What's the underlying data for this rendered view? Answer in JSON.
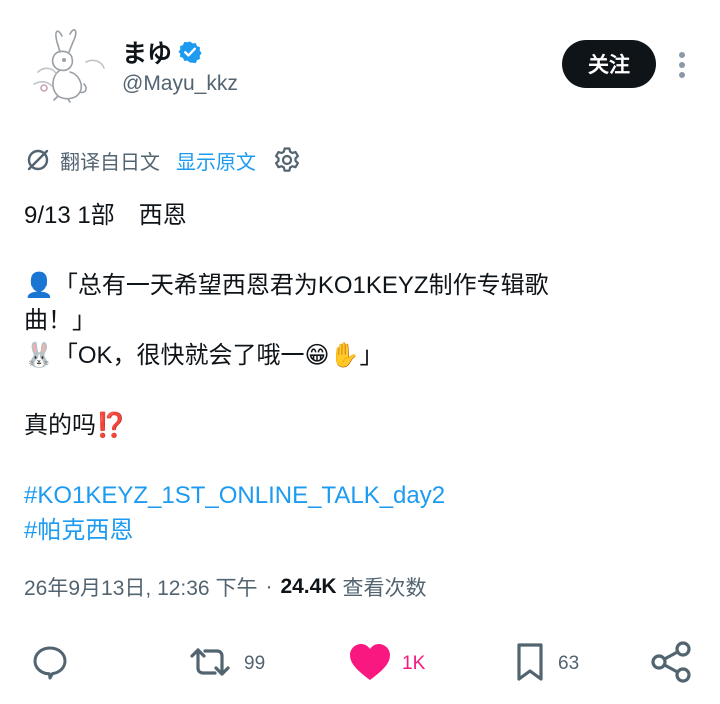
{
  "author": {
    "display_name": "まゆ",
    "handle": "@Mayu_kkz",
    "verified": true,
    "avatar_icon": "bunny-illustration"
  },
  "follow_button": {
    "label": "关注"
  },
  "more_menu": {
    "icon": "more-vertical-icon"
  },
  "translation": {
    "label": "翻译自日文",
    "show_original": "显示原文",
    "icon": "translate-icon",
    "settings_icon": "gear-icon"
  },
  "tweet": {
    "lines": [
      "9/13 1部　西恩",
      "",
      "👤「总有一天希望西恩君为KO1KEYZ制作专辑歌",
      "曲！」",
      "🐰「OK，很快就会了哦一😁✋」",
      "",
      "真的吗⁉️",
      ""
    ],
    "hashtags": [
      "#KO1KEYZ_1ST_ONLINE_TALK_day2",
      "#帕克西恩"
    ]
  },
  "meta": {
    "timestamp": "26年9月13日, 12:36 下午",
    "separator": "·",
    "views_count": "24.4K",
    "views_label": "查看次数"
  },
  "actions": {
    "reply": {
      "icon": "reply-icon",
      "count": ""
    },
    "retweet": {
      "icon": "retweet-icon",
      "count": "99"
    },
    "like": {
      "icon": "heart-icon",
      "count": "1K",
      "active": true
    },
    "bookmark": {
      "icon": "bookmark-icon",
      "count": "63"
    },
    "share": {
      "icon": "share-icon"
    }
  },
  "colors": {
    "accent": "#1d9bf0",
    "like": "#f91880",
    "text": "#0f1419",
    "muted": "#536471",
    "follow_bg": "#0f1419"
  }
}
